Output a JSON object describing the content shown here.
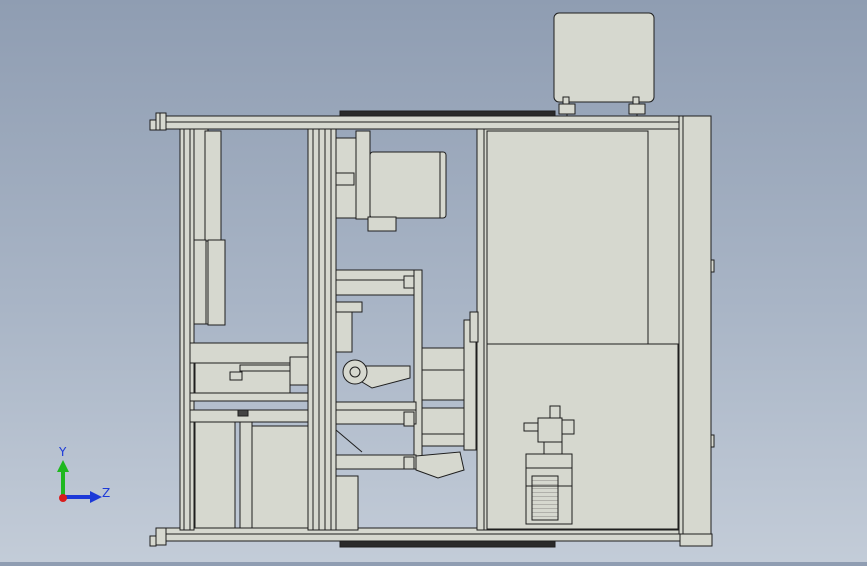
{
  "viewport": {
    "background_top": "#8f9db2",
    "background_bottom": "#c3ccd8",
    "part_fill": "#d6d8cf",
    "part_stroke": "#1e1e1e"
  },
  "triad": {
    "y_label": "Y",
    "z_label": "Z",
    "y_color": "#1fb81f",
    "z_color": "#1c39d8",
    "x_color": "#d81c1c"
  }
}
